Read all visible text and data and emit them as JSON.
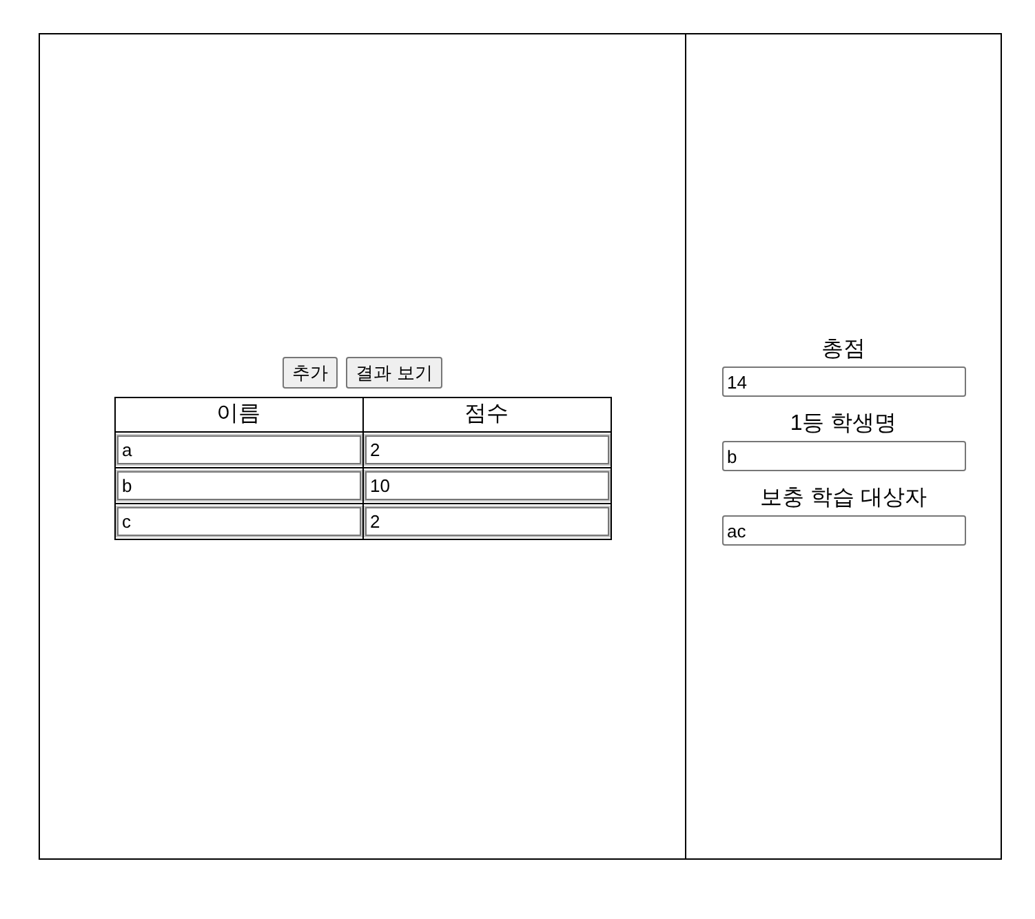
{
  "actions": [
    {
      "label": "추가"
    },
    {
      "label": "결과 보기"
    }
  ],
  "table": {
    "columns": [
      "이름",
      "점수"
    ],
    "rows": [
      [
        "a",
        "2"
      ],
      [
        "b",
        "10"
      ],
      [
        "c",
        "2"
      ]
    ]
  },
  "results": [
    {
      "label": "총점",
      "value": "14"
    },
    {
      "label": "1등 학생명",
      "value": "b"
    },
    {
      "label": "보충 학습 대상자",
      "value": "ac"
    }
  ]
}
